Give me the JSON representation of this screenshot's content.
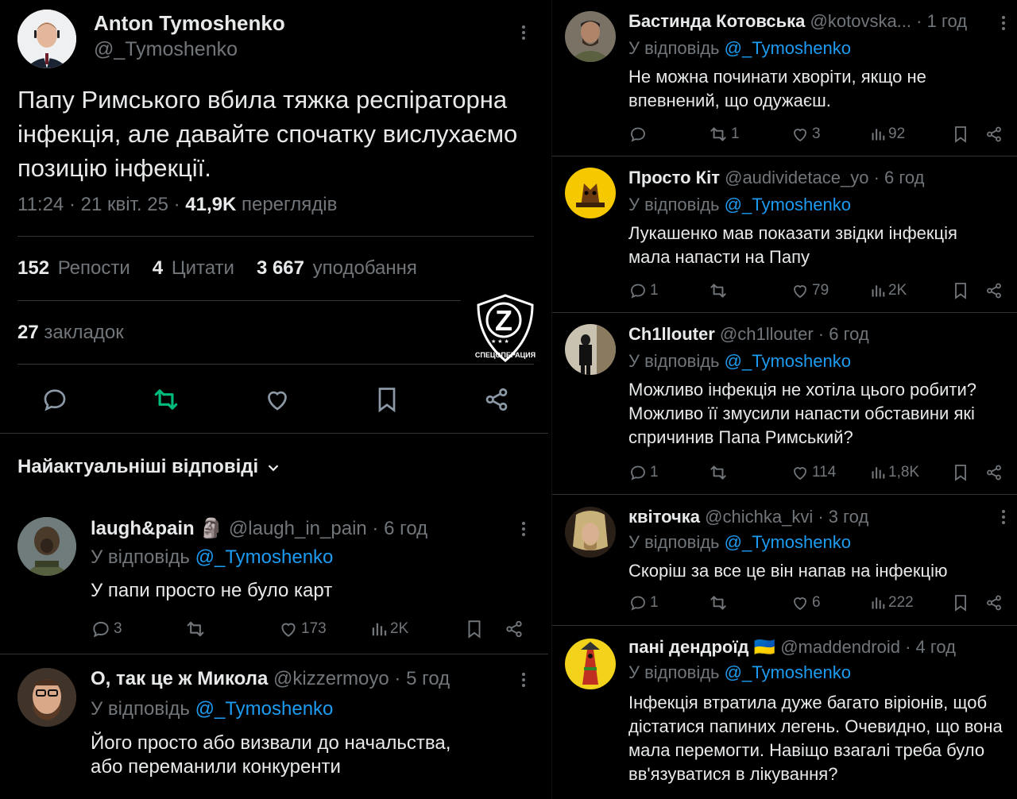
{
  "main_tweet": {
    "author_name": "Anton Tymoshenko",
    "author_handle": "@_Tymoshenko",
    "text": "Папу Римського вбила тяжка респіраторна інфекція, але давайте спочатку вислухаємо позицію інфекції.",
    "time": "11:24 · 21 квіт. 25 · ",
    "views_count": "41,9K",
    "views_label": "переглядів",
    "reposts_count": "152",
    "reposts_label": "Репости",
    "quotes_count": "4",
    "quotes_label": "Цитати",
    "likes_count": "3 667",
    "likes_label": "уподобання",
    "bookmarks_count": "27",
    "bookmarks_label": "закладок",
    "repost_color": "#00ba7c"
  },
  "replies_header": "Найактуальніші відповіді",
  "badge": {
    "letter": "Z",
    "text": "СПЕЦОПЕРАЦИЯ"
  },
  "left_replies": [
    {
      "name": "laugh&pain",
      "emoji": "🗿",
      "handle": "@laugh_in_pain",
      "time": "· 6 год",
      "reply_prefix": "У відповідь",
      "reply_to": "@_Tymoshenko",
      "text": "У папи просто не було карт",
      "replies": "3",
      "reposts": "",
      "likes": "173",
      "views": "2K"
    },
    {
      "name": "О, так це ж Микола",
      "handle": "@kizzermoyo",
      "time": "· 5 год",
      "reply_prefix": "У відповідь",
      "reply_to": "@_Tymoshenko",
      "text_line1": "Його просто або визвали до начальства,",
      "text_line2": "або переманили конкуренти"
    }
  ],
  "right_replies": [
    {
      "name": "Бастинда Котовська",
      "handle": "@kotovska...",
      "time": "· 1 год",
      "reply_prefix": "У відповідь",
      "reply_to": "@_Tymoshenko",
      "text": "Не можна починати хворіти, якщо не впевнений, що одужаєш.",
      "replies": "",
      "reposts": "1",
      "likes": "3",
      "views": "92"
    },
    {
      "name": "Просто Кіт",
      "handle": "@audividetace_yo",
      "time": "· 6 год",
      "reply_prefix": "У відповідь",
      "reply_to": "@_Tymoshenko",
      "text": "Лукашенко мав показати звідки інфекція мала напасти на Папу",
      "replies": "1",
      "reposts": "",
      "likes": "79",
      "views": "2K"
    },
    {
      "name": "Ch1llouter",
      "handle": "@ch1llouter",
      "time": "· 6 год",
      "reply_prefix": "У відповідь",
      "reply_to": "@_Tymoshenko",
      "text": "Можливо інфекція не хотіла цього робити? Можливо її змусили напасти обставини які спричинив Папа Римський?",
      "replies": "1",
      "reposts": "",
      "likes": "114",
      "views": "1,8K"
    },
    {
      "name": "квіточка",
      "handle": "@chichka_kvi",
      "time": "· 3 год",
      "reply_prefix": "У відповідь",
      "reply_to": "@_Tymoshenko",
      "text": "Скоріш за все це він напав на інфекцію",
      "replies": "1",
      "reposts": "",
      "likes": "6",
      "views": "222"
    },
    {
      "name": "пані дендроїд",
      "flag": "🇺🇦",
      "handle": "@maddendroid",
      "time": "· 4 год",
      "reply_prefix": "У відповідь",
      "reply_to": "@_Tymoshenko",
      "text": "Інфекція втратила дуже багато віріонів, щоб дістатися папиних легень. Очевидно, що вона мала перемогти. Навіщо взагалі треба було вв'язуватися в лікування?"
    }
  ]
}
